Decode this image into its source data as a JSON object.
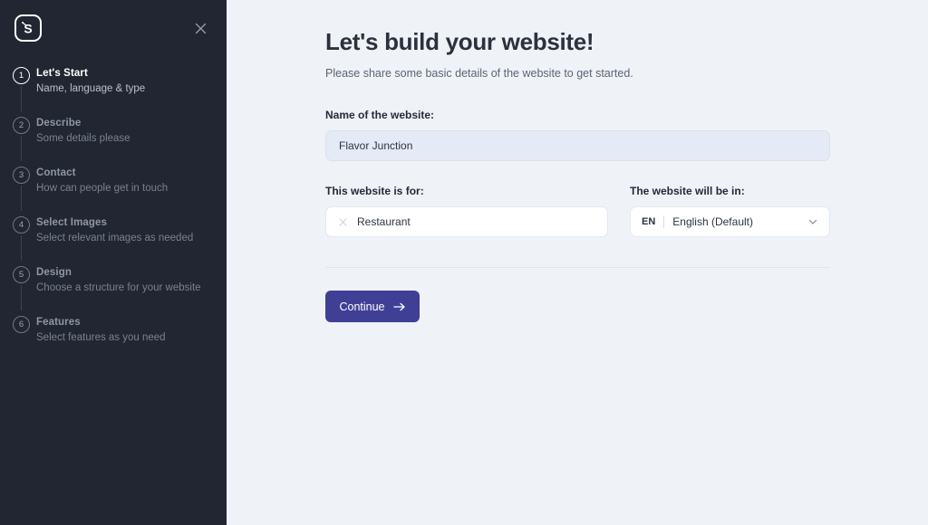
{
  "sidebar": {
    "logo_name": "spaceship-s-logo",
    "close_label": "Close",
    "steps": [
      {
        "number": "1",
        "title": "Let's Start",
        "desc": "Name, language & type"
      },
      {
        "number": "2",
        "title": "Describe",
        "desc": "Some details please"
      },
      {
        "number": "3",
        "title": "Contact",
        "desc": "How can people get in touch"
      },
      {
        "number": "4",
        "title": "Select Images",
        "desc": "Select relevant images as needed"
      },
      {
        "number": "5",
        "title": "Design",
        "desc": "Choose a structure for your website"
      },
      {
        "number": "6",
        "title": "Features",
        "desc": "Select features as you need"
      }
    ],
    "active_step_index": 0
  },
  "main": {
    "title": "Let's build your website!",
    "subtitle": "Please share some basic details of the website to get started.",
    "name_field": {
      "label": "Name of the website:",
      "value": "Flavor Junction",
      "placeholder": "Name of the website"
    },
    "purpose_field": {
      "label": "This website is for:",
      "value": "Restaurant",
      "clear_icon": "close-icon"
    },
    "language_field": {
      "label": "The website will be in:",
      "code": "EN",
      "value": "English (Default)",
      "chevron_icon": "chevron-down-icon"
    },
    "continue_button": {
      "label": "Continue",
      "icon": "arrow-right-icon"
    }
  },
  "colors": {
    "sidebar_bg": "#212632",
    "main_bg": "#eff2f7",
    "accent": "#3f4095",
    "input_fill": "#e4eaf6"
  }
}
